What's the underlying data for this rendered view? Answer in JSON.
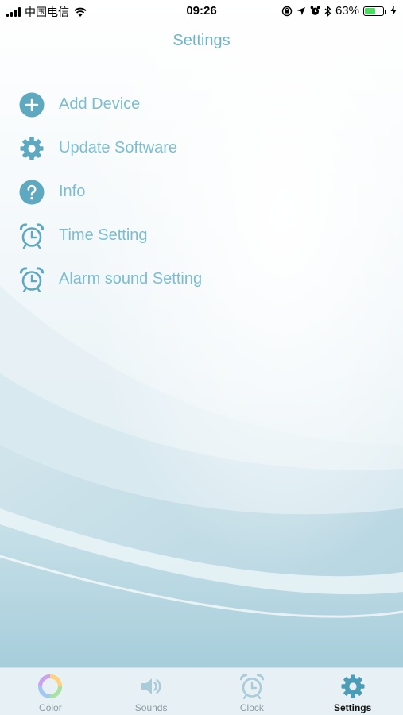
{
  "status_bar": {
    "carrier": "中国电信",
    "time": "09:26",
    "battery_percent": "63%",
    "battery_level": 0.63,
    "icons": [
      "signal-icon",
      "wifi-icon",
      "rotation-lock-icon",
      "location-icon",
      "alarm-icon",
      "bluetooth-icon",
      "battery-icon",
      "charging-icon"
    ]
  },
  "header": {
    "title": "Settings"
  },
  "settings": {
    "items": [
      {
        "label": "Add Device",
        "icon": "plus-circle-icon"
      },
      {
        "label": "Update Software",
        "icon": "gear-icon"
      },
      {
        "label": "Info",
        "icon": "question-circle-icon"
      },
      {
        "label": "Time Setting",
        "icon": "alarm-clock-icon"
      },
      {
        "label": "Alarm sound Setting",
        "icon": "alarm-clock-icon"
      }
    ]
  },
  "tab_bar": {
    "tabs": [
      {
        "label": "Color",
        "icon": "color-wheel-icon",
        "active": false
      },
      {
        "label": "Sounds",
        "icon": "speaker-icon",
        "active": false
      },
      {
        "label": "Clock",
        "icon": "alarm-clock-icon",
        "active": false
      },
      {
        "label": "Settings",
        "icon": "gear-icon",
        "active": true
      }
    ]
  },
  "colors": {
    "accent": "#5ea8c0",
    "label": "#7cbdd2",
    "title": "#6fb3cb",
    "tab_bar_bg": "#e7f1f5",
    "inactive_tab_icon": "#a9ccd8"
  }
}
